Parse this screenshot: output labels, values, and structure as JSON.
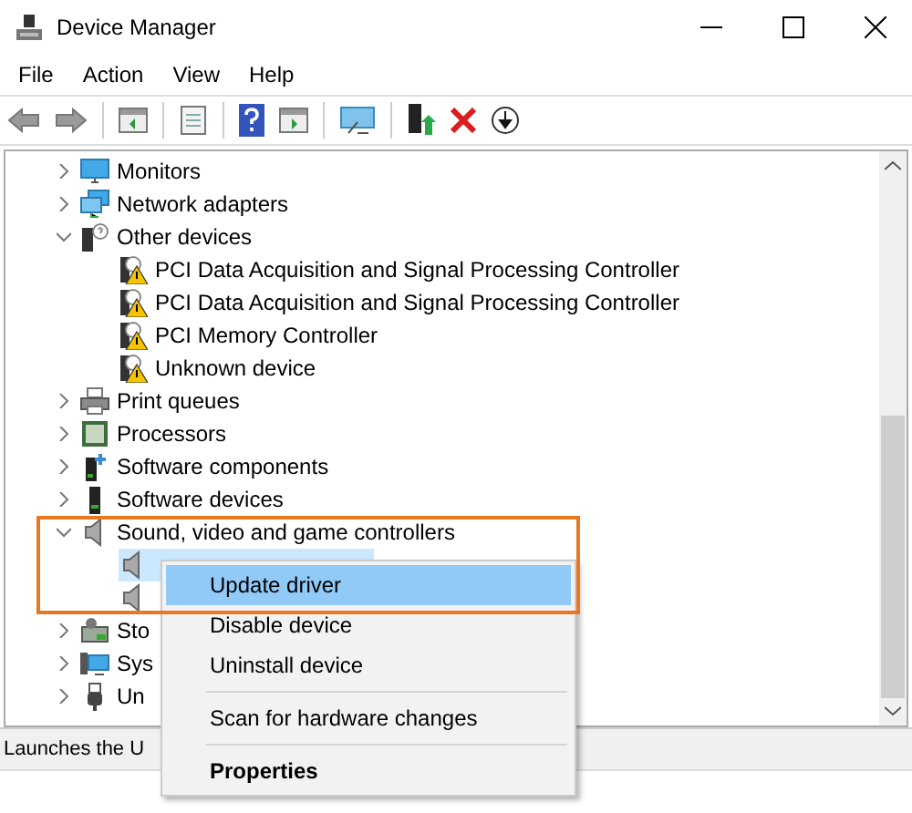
{
  "window": {
    "title": "Device Manager"
  },
  "menu": [
    "File",
    "Action",
    "View",
    "Help"
  ],
  "tree": [
    {
      "label": "Monitors",
      "expanded": false,
      "selected": false
    },
    {
      "label": "Network adapters",
      "expanded": false,
      "selected": false
    },
    {
      "label": "Other devices",
      "expanded": true,
      "selected": false,
      "children": [
        {
          "label": "PCI Data Acquisition and Signal Processing Controller",
          "selected": false
        },
        {
          "label": "PCI Data Acquisition and Signal Processing Controller",
          "selected": false
        },
        {
          "label": "PCI Memory Controller",
          "selected": false
        },
        {
          "label": "Unknown device",
          "selected": false
        }
      ]
    },
    {
      "label": "Print queues",
      "expanded": false,
      "selected": false
    },
    {
      "label": "Processors",
      "expanded": false,
      "selected": false
    },
    {
      "label": "Software components",
      "expanded": false,
      "selected": false
    },
    {
      "label": "Software devices",
      "expanded": false,
      "selected": false
    },
    {
      "label": "Sound, video and game controllers",
      "expanded": true,
      "selected": false,
      "children": [
        {
          "selected": true
        },
        {
          "selected": false
        }
      ]
    },
    {
      "label": "Sto",
      "expanded": false,
      "selected": false
    },
    {
      "label": "Sys",
      "expanded": false,
      "selected": false
    },
    {
      "label": "Un",
      "expanded": false,
      "selected": false
    }
  ],
  "context_menu": [
    {
      "kind": "item",
      "label": "Update driver",
      "selected": true,
      "default": false
    },
    {
      "kind": "item",
      "label": "Disable device",
      "selected": false,
      "default": false
    },
    {
      "kind": "item",
      "label": "Uninstall device",
      "selected": false,
      "default": false
    },
    {
      "kind": "separator"
    },
    {
      "kind": "item",
      "label": "Scan for hardware changes",
      "selected": false,
      "default": false
    },
    {
      "kind": "separator"
    },
    {
      "kind": "item",
      "label": "Properties",
      "selected": false,
      "default": true
    }
  ],
  "status_bar": "Launches the U"
}
